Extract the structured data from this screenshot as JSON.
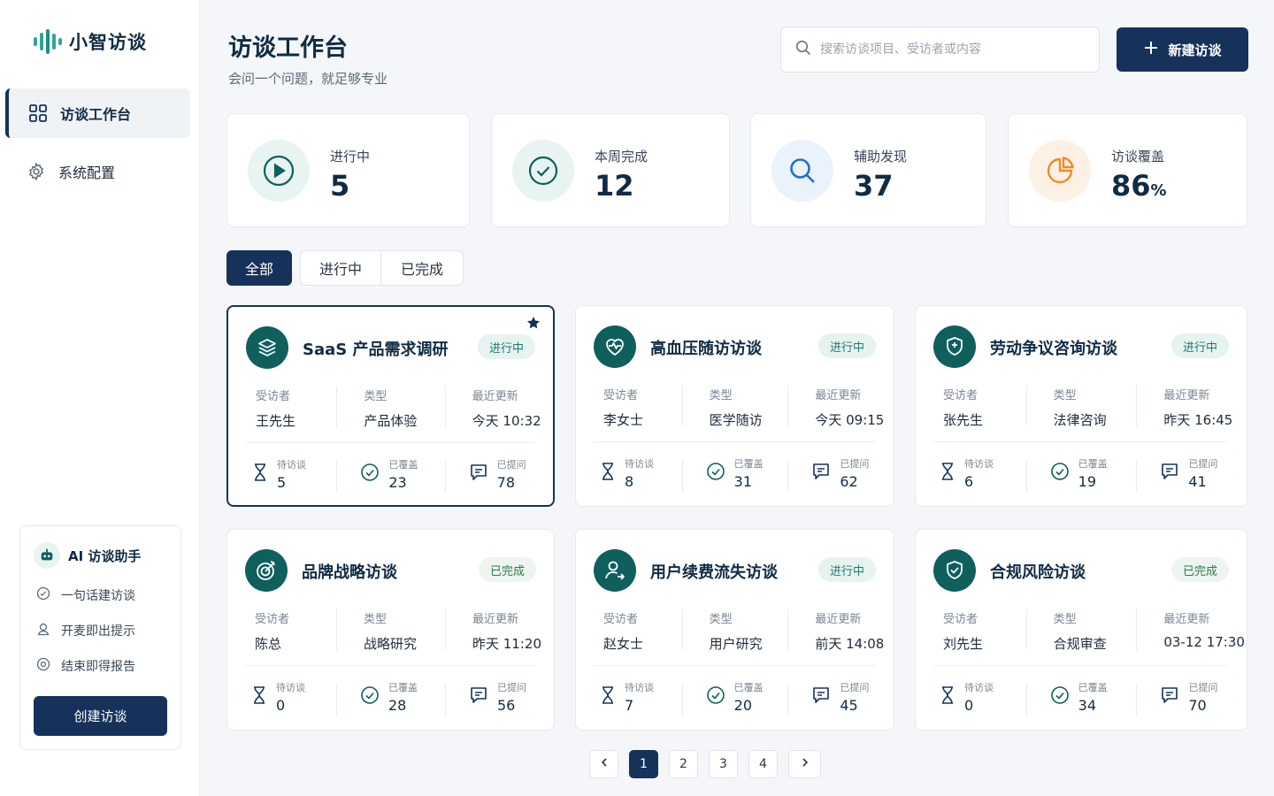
{
  "app": {
    "name": "小智访谈"
  },
  "sidebar": {
    "items": [
      {
        "label": "访谈工作台",
        "icon": "grid-icon",
        "active": true
      },
      {
        "label": "系统配置",
        "icon": "gear-icon",
        "active": false
      }
    ]
  },
  "assistant": {
    "title": "AI 访谈助手",
    "items": [
      {
        "label": "一句话建访谈",
        "icon": "sparkle-icon"
      },
      {
        "label": "开麦即出提示",
        "icon": "microphone-icon"
      },
      {
        "label": "结束即得报告",
        "icon": "report-icon"
      }
    ],
    "button_label": "创建访谈"
  },
  "header": {
    "title": "访谈工作台",
    "subtitle": "会问一个问题，就足够专业",
    "search_placeholder": "搜索访谈项目、受访者或内容",
    "new_button_label": "新建访谈"
  },
  "stats": [
    {
      "label": "进行中",
      "value": "5",
      "icon": "play-icon"
    },
    {
      "label": "本周完成",
      "value": "12",
      "icon": "check-circle-icon"
    },
    {
      "label": "辅助发现",
      "value": "37",
      "icon": "search-icon"
    },
    {
      "label": "访谈覆盖",
      "value": "86",
      "unit": "%",
      "icon": "pie-chart-icon"
    }
  ],
  "filters": {
    "all": "全部",
    "in_progress": "进行中",
    "done": "已完成"
  },
  "card_labels": {
    "interviewee": "受访者",
    "type": "类型",
    "updated": "最近更新",
    "pending": "待访谈",
    "covered": "已覆盖",
    "asked": "已提问"
  },
  "projects": [
    {
      "title": "SaaS 产品需求调研",
      "status": "进行中",
      "interviewee": "王先生",
      "type": "产品体验",
      "updated": "今天 10:32",
      "pending": "5",
      "covered": "23",
      "asked": "78",
      "icon": "layers-icon",
      "starred": true
    },
    {
      "title": "高血压随访访谈",
      "status": "进行中",
      "interviewee": "李女士",
      "type": "医学随访",
      "updated": "今天 09:15",
      "pending": "8",
      "covered": "31",
      "asked": "62",
      "icon": "heart-pulse-icon"
    },
    {
      "title": "劳动争议咨询访谈",
      "status": "进行中",
      "interviewee": "张先生",
      "type": "法律咨询",
      "updated": "昨天 16:45",
      "pending": "6",
      "covered": "19",
      "asked": "41",
      "icon": "shield-icon"
    },
    {
      "title": "品牌战略访谈",
      "status": "已完成",
      "interviewee": "陈总",
      "type": "战略研究",
      "updated": "昨天 11:20",
      "pending": "0",
      "covered": "28",
      "asked": "56",
      "icon": "target-icon"
    },
    {
      "title": "用户续费流失访谈",
      "status": "进行中",
      "interviewee": "赵女士",
      "type": "用户研究",
      "updated": "前天 14:08",
      "pending": "7",
      "covered": "20",
      "asked": "45",
      "icon": "user-arrow-icon"
    },
    {
      "title": "合规风险访谈",
      "status": "已完成",
      "interviewee": "刘先生",
      "type": "合规审查",
      "updated": "03-12 17:30",
      "pending": "0",
      "covered": "34",
      "asked": "70",
      "icon": "shield-check-icon"
    }
  ],
  "pagination": {
    "pages": [
      "1",
      "2",
      "3",
      "4"
    ],
    "current": "1"
  },
  "colors": {
    "primary": "#16325b",
    "accent": "#0f5f5d",
    "teal": "#2fa59a",
    "orange": "#f08a24",
    "blue": "#1f6fd1"
  }
}
